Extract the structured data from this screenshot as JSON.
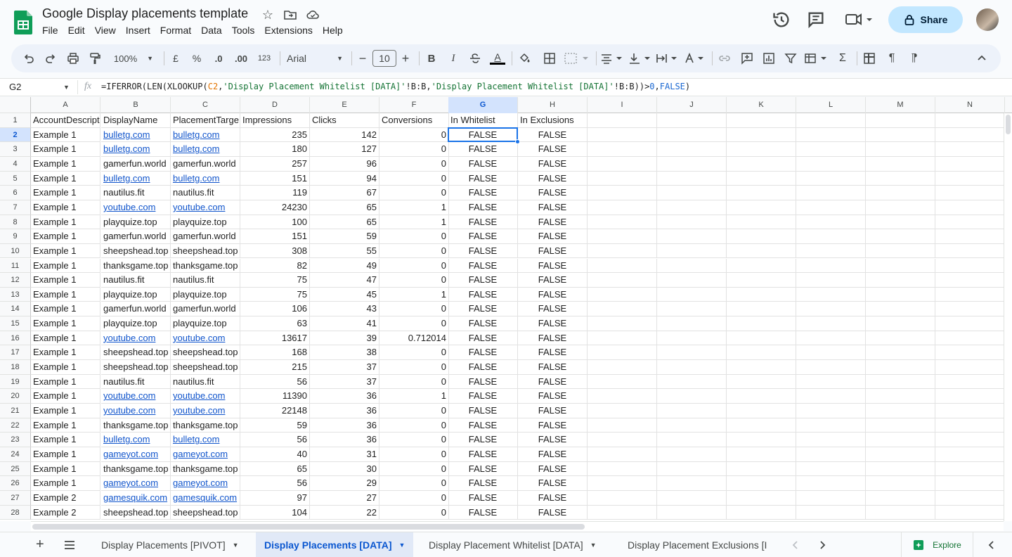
{
  "app": {
    "title": "Google Display placements template",
    "menu": [
      "File",
      "Edit",
      "View",
      "Insert",
      "Format",
      "Data",
      "Tools",
      "Extensions",
      "Help"
    ],
    "share_label": "Share"
  },
  "toolbar": {
    "zoom": "100%",
    "currency": "£",
    "percent": "%",
    "dec_decrease": ".0",
    "dec_increase": ".00",
    "format_number": "123",
    "font": "Arial",
    "font_size": "10",
    "bold": "B",
    "italic": "I"
  },
  "formula": {
    "cell_ref": "G2",
    "fx": "fx",
    "prefix": "=IFERROR(LEN(XLOOKUP(",
    "ref": "C2",
    "mid1": ",",
    "str1": "'Display Placement Whitelist [DATA]'",
    "mid2": "!B:B,",
    "str2": "'Display Placement Whitelist [DATA]'",
    "mid3": "!B:B))>",
    "num": "0",
    "mid4": ",",
    "bool": "FALSE",
    "suffix": ")"
  },
  "grid": {
    "columns": [
      "A",
      "B",
      "C",
      "D",
      "E",
      "F",
      "G",
      "H",
      "I",
      "J",
      "K",
      "L",
      "M",
      "N"
    ],
    "selected_column": "G",
    "selected_row": 2,
    "header_row": [
      "AccountDescript",
      "DisplayName",
      "PlacementTarge",
      "Impressions",
      "Clicks",
      "Conversions",
      "In Whitelist",
      "In Exclusions"
    ],
    "rows": [
      [
        "Example 1",
        "bulletg.com",
        "bulletg.com",
        "235",
        "142",
        "0",
        "FALSE",
        "FALSE"
      ],
      [
        "Example 1",
        "bulletg.com",
        "bulletg.com",
        "180",
        "127",
        "0",
        "FALSE",
        "FALSE"
      ],
      [
        "Example 1",
        "gamerfun.world",
        "gamerfun.world",
        "257",
        "96",
        "0",
        "FALSE",
        "FALSE"
      ],
      [
        "Example 1",
        "bulletg.com",
        "bulletg.com",
        "151",
        "94",
        "0",
        "FALSE",
        "FALSE"
      ],
      [
        "Example 1",
        "nautilus.fit",
        "nautilus.fit",
        "119",
        "67",
        "0",
        "FALSE",
        "FALSE"
      ],
      [
        "Example 1",
        "youtube.com",
        "youtube.com",
        "24230",
        "65",
        "1",
        "FALSE",
        "FALSE"
      ],
      [
        "Example 1",
        "playquize.top",
        "playquize.top",
        "100",
        "65",
        "1",
        "FALSE",
        "FALSE"
      ],
      [
        "Example 1",
        "gamerfun.world",
        "gamerfun.world",
        "151",
        "59",
        "0",
        "FALSE",
        "FALSE"
      ],
      [
        "Example 1",
        "sheepshead.top",
        "sheepshead.top",
        "308",
        "55",
        "0",
        "FALSE",
        "FALSE"
      ],
      [
        "Example 1",
        "thanksgame.top",
        "thanksgame.top",
        "82",
        "49",
        "0",
        "FALSE",
        "FALSE"
      ],
      [
        "Example 1",
        "nautilus.fit",
        "nautilus.fit",
        "75",
        "47",
        "0",
        "FALSE",
        "FALSE"
      ],
      [
        "Example 1",
        "playquize.top",
        "playquize.top",
        "75",
        "45",
        "1",
        "FALSE",
        "FALSE"
      ],
      [
        "Example 1",
        "gamerfun.world",
        "gamerfun.world",
        "106",
        "43",
        "0",
        "FALSE",
        "FALSE"
      ],
      [
        "Example 1",
        "playquize.top",
        "playquize.top",
        "63",
        "41",
        "0",
        "FALSE",
        "FALSE"
      ],
      [
        "Example 1",
        "youtube.com",
        "youtube.com",
        "13617",
        "39",
        "0.712014",
        "FALSE",
        "FALSE"
      ],
      [
        "Example 1",
        "sheepshead.top",
        "sheepshead.top",
        "168",
        "38",
        "0",
        "FALSE",
        "FALSE"
      ],
      [
        "Example 1",
        "sheepshead.top",
        "sheepshead.top",
        "215",
        "37",
        "0",
        "FALSE",
        "FALSE"
      ],
      [
        "Example 1",
        "nautilus.fit",
        "nautilus.fit",
        "56",
        "37",
        "0",
        "FALSE",
        "FALSE"
      ],
      [
        "Example 1",
        "youtube.com",
        "youtube.com",
        "11390",
        "36",
        "1",
        "FALSE",
        "FALSE"
      ],
      [
        "Example 1",
        "youtube.com",
        "youtube.com",
        "22148",
        "36",
        "0",
        "FALSE",
        "FALSE"
      ],
      [
        "Example 1",
        "thanksgame.top",
        "thanksgame.top",
        "59",
        "36",
        "0",
        "FALSE",
        "FALSE"
      ],
      [
        "Example 1",
        "bulletg.com",
        "bulletg.com",
        "56",
        "36",
        "0",
        "FALSE",
        "FALSE"
      ],
      [
        "Example 1",
        "gameyot.com",
        "gameyot.com",
        "40",
        "31",
        "0",
        "FALSE",
        "FALSE"
      ],
      [
        "Example 1",
        "thanksgame.top",
        "thanksgame.top",
        "65",
        "30",
        "0",
        "FALSE",
        "FALSE"
      ],
      [
        "Example 1",
        "gameyot.com",
        "gameyot.com",
        "56",
        "29",
        "0",
        "FALSE",
        "FALSE"
      ],
      [
        "Example 2",
        "gamesquik.com",
        "gamesquik.com",
        "97",
        "27",
        "0",
        "FALSE",
        "FALSE"
      ],
      [
        "Example 2",
        "sheepshead.top",
        "sheepshead.top",
        "104",
        "22",
        "0",
        "FALSE",
        "FALSE"
      ]
    ],
    "linked_domains": [
      "bulletg.com",
      "youtube.com",
      "gameyot.com",
      "gamesquik.com"
    ]
  },
  "tabs": {
    "sheets": [
      "Display Placements [PIVOT]",
      "Display Placements [DATA]",
      "Display Placement Whitelist [DATA]",
      "Display Placement Exclusions [I"
    ],
    "active_index": 1,
    "explore_label": "Explore"
  },
  "colors": {
    "accent": "#0b57d0",
    "link": "#1155cc",
    "share_bg": "#c2e7ff",
    "sheets_green": "#0f9d58"
  }
}
